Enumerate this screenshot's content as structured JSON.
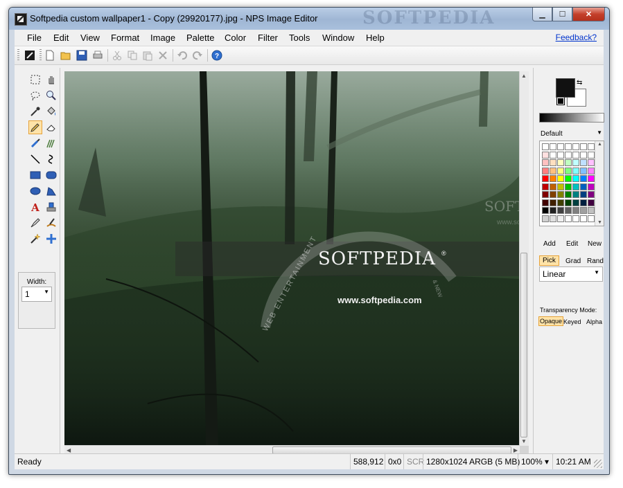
{
  "window": {
    "title": "Softpedia custom wallpaper1 - Copy (29920177).jpg - NPS Image Editor",
    "title_watermark": "SOFTPEDIA",
    "controls": {
      "minimize": "▁",
      "maximize": "☐",
      "close": "✕"
    }
  },
  "menu": {
    "items": [
      "File",
      "Edit",
      "View",
      "Format",
      "Image",
      "Palette",
      "Color",
      "Filter",
      "Tools",
      "Window",
      "Help"
    ],
    "feedback": "Feedback?"
  },
  "toolbar": {
    "buttons": [
      "app-icon",
      "new-file-icon",
      "open-folder-icon",
      "save-icon",
      "print-icon",
      "cut-icon",
      "copy-icon",
      "paste-icon",
      "delete-icon",
      "undo-icon",
      "redo-icon",
      "help-icon"
    ]
  },
  "tools": {
    "items": [
      "rect-select-icon",
      "hand-pan-icon",
      "lasso-icon",
      "zoom-icon",
      "eyedropper-icon",
      "fill-bucket-icon",
      "pencil-icon",
      "eraser-icon",
      "brush-icon",
      "stamp-icon",
      "line-icon",
      "curve-icon",
      "rectangle-icon",
      "rounded-rect-icon",
      "ellipse-icon",
      "polygon-icon",
      "text-icon",
      "clone-icon",
      "pen-icon",
      "smudge-icon",
      "magic-wand-icon",
      "crosshair-icon"
    ],
    "active": "pencil-icon",
    "width_label": "Width:",
    "width_value": "1"
  },
  "image": {
    "logo": "SOFTPEDIA",
    "reg": "®",
    "url": "www.softpedia.com",
    "arc_text": "WEB   ENTERTAINMENT",
    "arc_text2": "& NEW",
    "watermark": "SOFTPEDIA",
    "watermark_url": "www.softpedia.com"
  },
  "colors": {
    "foreground": "#111111",
    "background": "#ffffff",
    "palette_name": "Default",
    "palette": [
      [
        "#ffffff",
        "#ffffff",
        "#ffffff",
        "#ffffff",
        "#ffffff",
        "#ffffff",
        "#ffffff"
      ],
      [
        "#ffe0e0",
        "#ffffff",
        "#ffffff",
        "#ffffff",
        "#ffffff",
        "#ffffff",
        "#ffffff"
      ],
      [
        "#ffc0c0",
        "#ffe0c0",
        "#ffffc0",
        "#c0ffc0",
        "#c0ffff",
        "#c0e0ff",
        "#ffc0ff"
      ],
      [
        "#ff8080",
        "#ffc080",
        "#ffff80",
        "#80ff80",
        "#80ffff",
        "#80c0ff",
        "#ff80ff"
      ],
      [
        "#ff0000",
        "#ff8000",
        "#ffff00",
        "#00ff00",
        "#00ffff",
        "#0080ff",
        "#ff00ff"
      ],
      [
        "#c00000",
        "#c06000",
        "#c0c000",
        "#00c000",
        "#00c0c0",
        "#0060c0",
        "#c000c0"
      ],
      [
        "#800000",
        "#804000",
        "#808000",
        "#008000",
        "#008080",
        "#004080",
        "#800080"
      ],
      [
        "#400000",
        "#402000",
        "#404000",
        "#004000",
        "#004040",
        "#002040",
        "#400040"
      ],
      [
        "#000000",
        "#202020",
        "#404040",
        "#606060",
        "#808080",
        "#a0a0a0",
        "#c0c0c0"
      ],
      [
        "#d0d0d0",
        "#e0e0e0",
        "#f0f0f0",
        "#ffffff",
        "#ffffff",
        "#ffffff",
        "#ffffff"
      ]
    ],
    "palette_buttons": [
      "Add",
      "Edit",
      "New"
    ],
    "gradient_buttons": [
      "Pick",
      "Grad",
      "Rand"
    ],
    "gradient_active": "Pick",
    "gradient_mode": "Linear",
    "transparency_label": "Transparency Mode:",
    "transparency_buttons": [
      "Opaque",
      "Keyed",
      "Alpha"
    ],
    "transparency_active": "Opaque"
  },
  "status": {
    "ready": "Ready",
    "coords": "588,912",
    "selection": "0x0",
    "scr": "SCR",
    "image_info": "1280x1024 ARGB (5 MB)",
    "zoom": "100%",
    "zoom_arrow": "▾",
    "time": "10:21 AM"
  }
}
